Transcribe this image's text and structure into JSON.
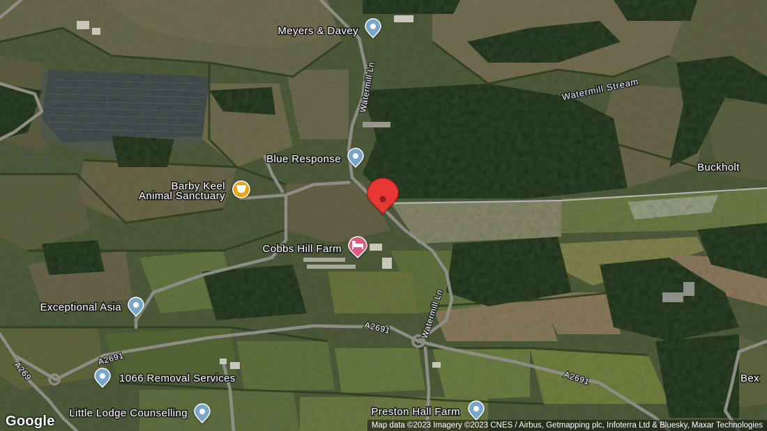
{
  "map": {
    "type": "satellite",
    "places": [
      {
        "id": "meyers-davey",
        "label": "Meyers & Davey",
        "icon": "place-pin-icon"
      },
      {
        "id": "blue-response",
        "label": "Blue Response",
        "icon": "place-pin-icon"
      },
      {
        "id": "barby-keel",
        "label_line1": "Barby Keel",
        "label_line2": "Animal Sanctuary",
        "icon": "cafe-cup-icon"
      },
      {
        "id": "cobbs-hill-farm",
        "label": "Cobbs Hill Farm",
        "icon": "lodging-bed-icon"
      },
      {
        "id": "exceptional-asia",
        "label": "Exceptional Asia",
        "icon": "place-pin-icon"
      },
      {
        "id": "removal-services",
        "label": "1066 Removal Services",
        "icon": "place-pin-icon"
      },
      {
        "id": "little-lodge",
        "label": "Little Lodge Counselling",
        "icon": "place-pin-icon"
      },
      {
        "id": "preston-hall",
        "label": "Preston Hall Farm",
        "icon": "place-pin-icon"
      },
      {
        "id": "buckholt",
        "label": "Buckholt",
        "icon": ""
      },
      {
        "id": "bex",
        "label": "Bex",
        "icon": ""
      }
    ],
    "roads": {
      "watermill_ln": "Watermill Ln",
      "a2691": "A2691",
      "a269": "A269"
    },
    "water": {
      "stream": "Watermill Stream"
    },
    "marker": {
      "icon": "red-location-marker-icon"
    },
    "colors": {
      "pin_blue": "#7aa7c7",
      "cafe_orange": "#e8a317",
      "lodging_pink": "#e2577f",
      "marker_red": "#e53935"
    }
  },
  "footer": {
    "logo": "Google",
    "attribution": "Map data ©2023 Imagery ©2023 CNES / Airbus, Getmapping plc, Infoterra Ltd & Bluesky, Maxar Technologies"
  }
}
